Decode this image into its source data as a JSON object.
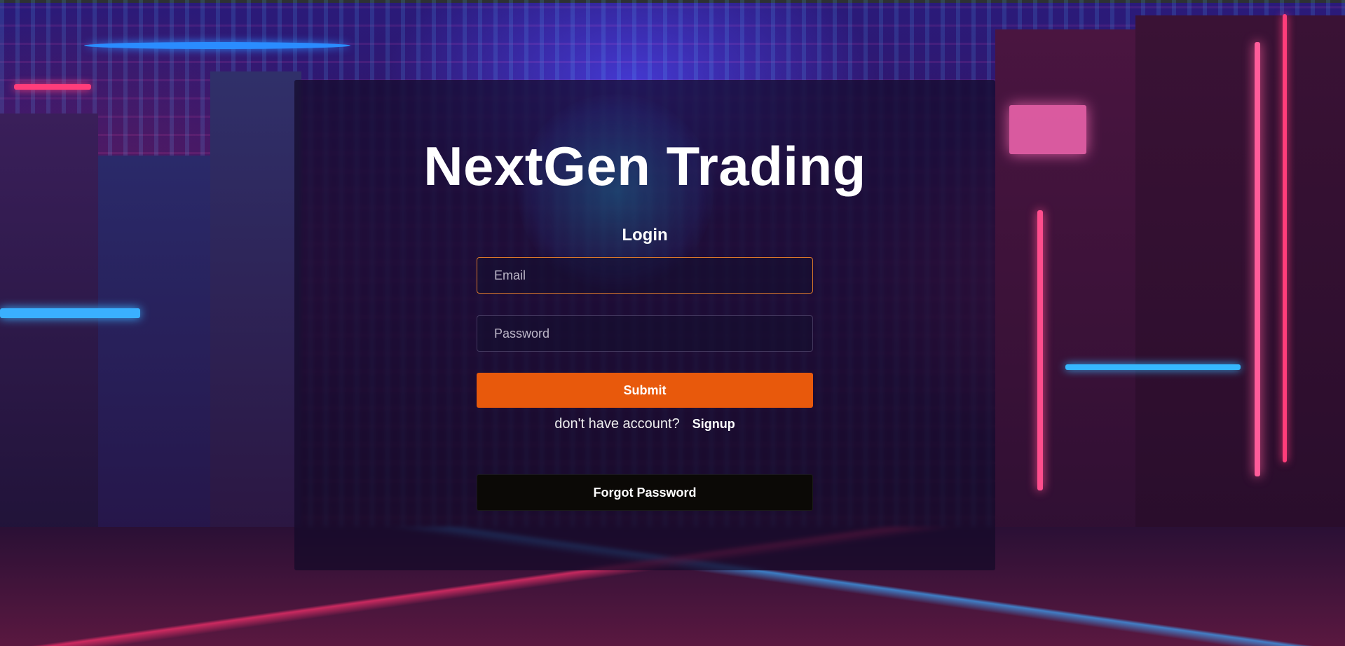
{
  "app": {
    "title": "NextGen Trading"
  },
  "form": {
    "heading": "Login",
    "email_placeholder": "Email",
    "email_value": "",
    "password_placeholder": "Password",
    "password_value": "",
    "submit_label": "Submit",
    "signup_prompt": "don't have account?",
    "signup_link": "Signup",
    "forgot_label": "Forgot Password"
  },
  "colors": {
    "accent": "#e8590c",
    "focus_border": "#d9782a",
    "dark_button": "#0b0906"
  }
}
